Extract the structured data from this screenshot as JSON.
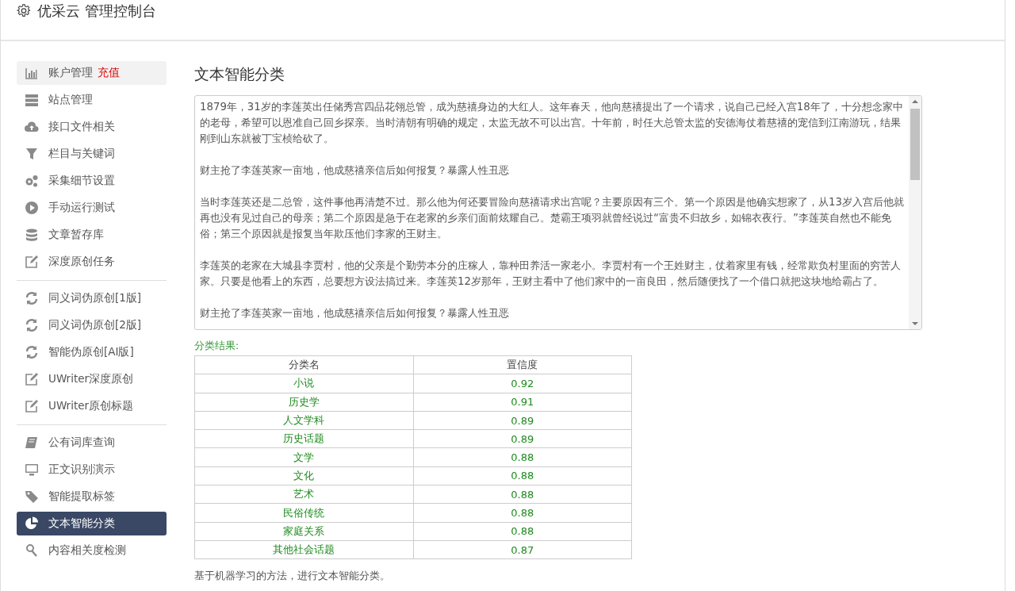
{
  "header": {
    "title": "优采云 管理控制台"
  },
  "sidebar": {
    "groups": [
      [
        {
          "label": "账户管理",
          "badge": "充值",
          "highlighted": true,
          "selected": false
        },
        {
          "label": "站点管理",
          "highlighted": false,
          "selected": false
        },
        {
          "label": "接口文件相关",
          "highlighted": false,
          "selected": false
        },
        {
          "label": "栏目与关键词",
          "highlighted": false,
          "selected": false
        },
        {
          "label": "采集细节设置",
          "highlighted": false,
          "selected": false
        },
        {
          "label": "手动运行测试",
          "highlighted": false,
          "selected": false
        },
        {
          "label": "文章暂存库",
          "highlighted": false,
          "selected": false
        },
        {
          "label": "深度原创任务",
          "highlighted": false,
          "selected": false
        }
      ],
      [
        {
          "label": "同义词伪原创[1版]",
          "highlighted": false,
          "selected": false
        },
        {
          "label": "同义词伪原创[2版]",
          "highlighted": false,
          "selected": false
        },
        {
          "label": "智能伪原创[AI版]",
          "highlighted": false,
          "selected": false
        },
        {
          "label": "UWriter深度原创",
          "highlighted": false,
          "selected": false
        },
        {
          "label": "UWriter原创标题",
          "highlighted": false,
          "selected": false
        }
      ],
      [
        {
          "label": "公有词库查询",
          "highlighted": false,
          "selected": false
        },
        {
          "label": "正文识别演示",
          "highlighted": false,
          "selected": false
        },
        {
          "label": "智能提取标签",
          "highlighted": false,
          "selected": false
        },
        {
          "label": "文本智能分类",
          "highlighted": false,
          "selected": true
        },
        {
          "label": "内容相关度检测",
          "highlighted": false,
          "selected": false
        }
      ]
    ]
  },
  "main": {
    "title": "文本智能分类",
    "text_input": {
      "paragraphs": [
        "1879年，31岁的李莲英出任储秀宫四品花翎总管，成为慈禧身边的大红人。这年春天，他向慈禧提出了一个请求，说自己已经入宫18年了，十分想念家中的老母，希望可以恩准自己回乡探亲。当时清朝有明确的规定，太监无故不可以出宫。十年前，时任大总管太监的安德海仗着慈禧的宠信到江南游玩，结果刚到山东就被丁宝桢给砍了。",
        "财主抢了李莲英家一亩地，他成慈禧亲信后如何报复？暴露人性丑恶",
        "当时李莲英还是二总管，这件事他再清楚不过。那么他为何还要冒险向慈禧请求出宫呢？主要原因有三个。第一个原因是他确实想家了，从13岁入宫后他就再也没有见过自己的母亲；第二个原因是急于在老家的乡亲们面前炫耀自己。楚霸王项羽就曾经说过“富贵不归故乡，如锦衣夜行。”李莲英自然也不能免俗；第三个原因就是报复当年欺压他们李家的王财主。",
        "李莲英的老家在大城县李贾村，他的父亲是个勤劳本分的庄稼人，靠种田养活一家老小。李贾村有一个王姓财主，仗着家里有钱，经常欺负村里面的穷苦人家。只要是他看上的东西，总要想方设法搞过来。李莲英12岁那年，王财主看中了他们家中的一亩良田，然后随便找了一个借口就把这块地给霸占了。",
        "财主抢了李莲英家一亩地，他成慈禧亲信后如何报复？暴露人性丑恶"
      ]
    },
    "result_label": "分类结果:",
    "table": {
      "columns": [
        "分类名",
        "置信度"
      ],
      "rows": [
        [
          "小说",
          "0.92"
        ],
        [
          "历史学",
          "0.91"
        ],
        [
          "人文学科",
          "0.89"
        ],
        [
          "历史话题",
          "0.89"
        ],
        [
          "文学",
          "0.88"
        ],
        [
          "文化",
          "0.88"
        ],
        [
          "艺术",
          "0.88"
        ],
        [
          "民俗传统",
          "0.88"
        ],
        [
          "家庭关系",
          "0.88"
        ],
        [
          "其他社会话题",
          "0.87"
        ]
      ]
    },
    "note": "基于机器学习的方法，进行文本智能分类。"
  }
}
